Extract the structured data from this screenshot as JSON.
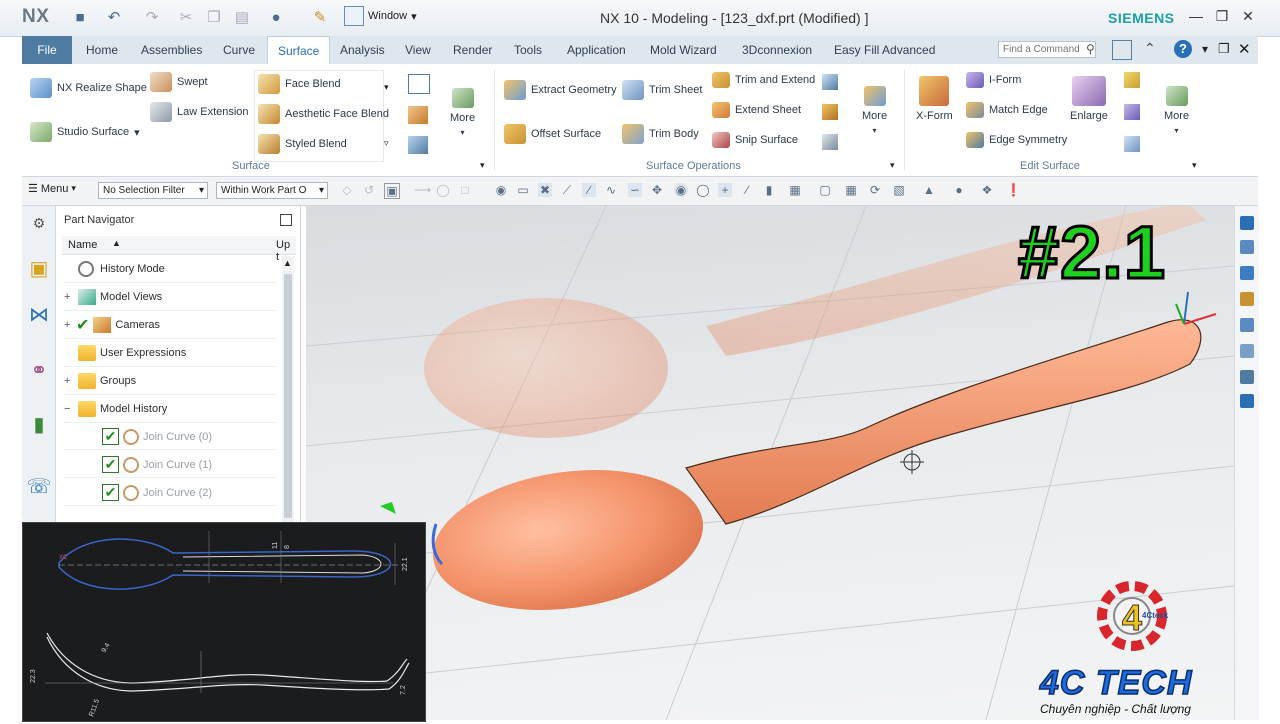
{
  "app": {
    "logo": "NX",
    "window_title": "NX 10 - Modeling - [123_dxf.prt (Modified) ]",
    "vendor": "SIEMENS",
    "window_menu": "Window"
  },
  "menu": {
    "tabs": [
      "File",
      "Home",
      "Assemblies",
      "Curve",
      "Surface",
      "Analysis",
      "View",
      "Render",
      "Tools",
      "Application",
      "Mold Wizard",
      "3Dconnexion",
      "Easy Fill Advanced"
    ],
    "active": "Surface",
    "find_placeholder": "Find a Command"
  },
  "ribbon": {
    "surface_group": {
      "label": "Surface",
      "items": [
        "NX Realize Shape",
        "Studio Surface",
        "Swept",
        "Law Extension",
        "Face Blend",
        "Aesthetic Face Blend",
        "Styled Blend",
        "More"
      ]
    },
    "surface_operations": {
      "label": "Surface Operations",
      "items": [
        "Extract Geometry",
        "Offset Surface",
        "Trim Sheet",
        "Trim Body",
        "Trim and Extend",
        "Extend Sheet",
        "Snip Surface",
        "More"
      ]
    },
    "edit_surface": {
      "label": "Edit Surface",
      "items": [
        "X-Form",
        "I-Form",
        "Match Edge",
        "Edge Symmetry",
        "Enlarge",
        "More"
      ]
    }
  },
  "selection_bar": {
    "menu": "Menu",
    "filter": "No Selection Filter",
    "scope": "Within Work Part O"
  },
  "navigator": {
    "title": "Part Navigator",
    "col_name": "Name",
    "col_up": "Up t",
    "rows": [
      {
        "label": "History Mode",
        "expand": "",
        "icon": "clock-icon"
      },
      {
        "label": "Model Views",
        "expand": "+",
        "icon": "views-icon"
      },
      {
        "label": "Cameras",
        "expand": "+",
        "icon": "camera-icon"
      },
      {
        "label": "User Expressions",
        "expand": "",
        "icon": "folder-icon"
      },
      {
        "label": "Groups",
        "expand": "+",
        "icon": "folder-icon"
      },
      {
        "label": "Model History",
        "expand": "−",
        "icon": "folder-icon"
      },
      {
        "label": "Join Curve (0)",
        "expand": "",
        "icon": "curve-icon"
      },
      {
        "label": "Join Curve (1)",
        "expand": "",
        "icon": "curve-icon"
      },
      {
        "label": "Join Curve (2)",
        "expand": "",
        "icon": "curve-icon"
      }
    ]
  },
  "overlay": {
    "episode": "#2.1",
    "brand": "4C TECH",
    "slogan": "Chuyên nghiệp - Chất lượng",
    "logo_text": "4Cteck"
  },
  "sketch_dims": {
    "top": [
      "11",
      "8",
      "22.1"
    ],
    "bottom": [
      "22.3",
      "9.4",
      "R11.5",
      "7.2"
    ]
  },
  "colors": {
    "accent": "#2a6fb5",
    "spoon": "#f4936b",
    "brand": "#1e6be0",
    "episode": "#1fd11f"
  }
}
